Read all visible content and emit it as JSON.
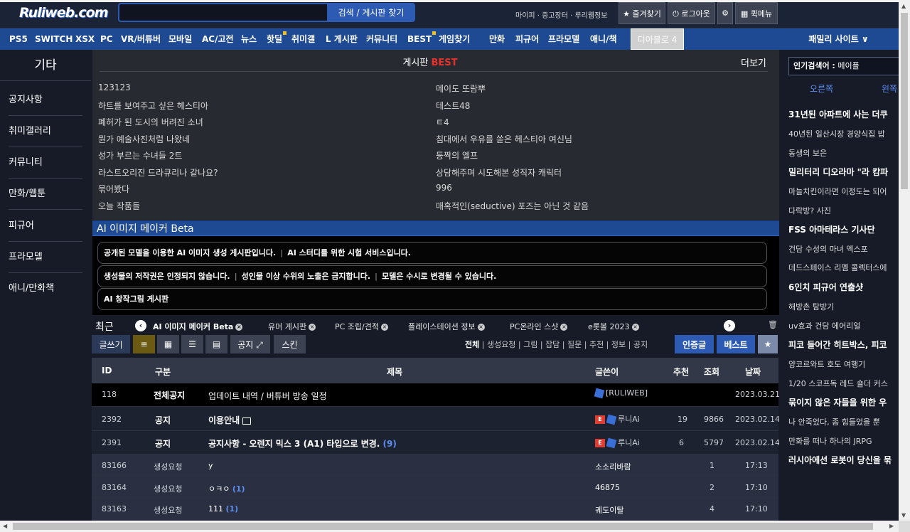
{
  "header": {
    "logo": "Ruliweb.com",
    "search_placeholder": "",
    "search_button": "검색 / 게시판 찾기",
    "top_links": "마이피 · 중고장터 · 루리웹정보",
    "favorites": "★ 즐겨찾기",
    "logout": "⏻ 로그아웃",
    "settings": "⚙",
    "quickmenu": "▦ 퀵메뉴"
  },
  "nav": [
    "PS5",
    "SWITCH",
    "XSX",
    "PC",
    "VR/버튜버",
    "모바일",
    "AC/고전",
    "뉴스",
    "핫딜",
    "취미갤",
    "L 게시판",
    "커뮤니티",
    "BEST",
    "게임찾기",
    "만화",
    "피규어",
    "프라모델",
    "애니/책"
  ],
  "nav_extra": {
    "diablo": "디아블로 4",
    "family": "패밀리 사이트 ∨"
  },
  "sidebar": {
    "title": "기타",
    "items": [
      "공지사항",
      "취미갤러리",
      "커뮤니티",
      "만화/웹툰",
      "피규어",
      "프라모델",
      "애니/만화책"
    ]
  },
  "best": {
    "title": "게시판",
    "title_accent": "BEST",
    "more": "더보기",
    "left": [
      "123123",
      "하트를 보여주고 싶은 헤스티아",
      "폐허가 된 도시의 버려진 소녀",
      "뭔가 예술사진처럼 나왔네",
      "성가 부르는 수녀들 2트",
      "라스트오리진 드라큐리나 같나요?",
      "묶어봤다",
      "오늘 작품들"
    ],
    "right": [
      "메이도 또람뿌",
      "테스트48",
      "ㅌ4",
      "침대에서 우유를 쏟은 헤스티아 여신님",
      "등짝의 엘프",
      "상담해주며 시도해본 성직자 캐릭터",
      "996",
      "매혹적인(seductive) 포즈는 아닌 것 같음"
    ]
  },
  "board": {
    "title": "AI 이미지 메이커 Beta",
    "notice1a": "공개된 모델을 이용한 AI 이미지 생성 게시판입니다.",
    "notice1b": "AI 스터디를 위한 시험 서비스입니다.",
    "notice2a": "생성물의 저작권은 인정되지 않습니다.",
    "notice2b": "성인물 이상 수위의 노출은 금지합니다.",
    "notice2c": "모델은 수시로 변경될 수 있습니다.",
    "notice3": "AI 창작그림 게시판",
    "sep": "|"
  },
  "recent": {
    "label": "최근",
    "items": [
      "AI 이미지 메이커 Beta",
      "유머 게시판",
      "PC 조립/견적",
      "플레이스테이션 정보",
      "PC온라인 스샷",
      "e롯볼 2023"
    ],
    "trash": "🗑"
  },
  "toolbar": {
    "write": "글쓰기",
    "notice": "공지 ⤢",
    "skin": "스킨",
    "filters_active": "전체",
    "filters": " | 생성요청 | 그림 | 잡담 | 질문 | 추천 | 정보 | 공지",
    "cert": "인증글",
    "best": "베스트",
    "star": "★"
  },
  "table": {
    "headers": {
      "id": "ID",
      "cat": "구분",
      "title": "제목",
      "author": "글쓴이",
      "rec": "추천",
      "views": "조회",
      "date": "날짜"
    },
    "rows": [
      {
        "id": "118",
        "cat": "전체공지",
        "title": "업데이트 내역 / 버튜버 방송 일정",
        "comments": "",
        "author": "[RULIWEB]",
        "rec": "",
        "views": "",
        "date": "2023.03.21"
      },
      {
        "id": "2392",
        "cat": "공지",
        "title": "이용안내",
        "comments": "",
        "author": "루니Ai",
        "rec": "19",
        "views": "9866",
        "date": "2023.02.14"
      },
      {
        "id": "2391",
        "cat": "공지",
        "title": "공지사항 - 오렌지 믹스 3 (A1) 타입으로 변경.",
        "comments": "(9)",
        "author": "루니Ai",
        "rec": "6",
        "views": "5797",
        "date": "2023.02.14"
      },
      {
        "id": "83166",
        "cat": "생성요청",
        "title": "y",
        "comments": "",
        "author": "소소리바람",
        "rec": "1",
        "views": "",
        "date": "17:13"
      },
      {
        "id": "83164",
        "cat": "생성요청",
        "title": "ㅇㅋㅇ",
        "comments": "(1)",
        "author": "46875",
        "rec": "2",
        "views": "",
        "date": "17:10"
      },
      {
        "id": "83163",
        "cat": "생성요청",
        "title": "111",
        "comments": "(1)",
        "author": "궤도이탈",
        "rec": "4",
        "views": "",
        "date": "17:10"
      }
    ]
  },
  "right": {
    "pop_label": "인기검색어 :",
    "pop_value": "메이플",
    "tabs": [
      "오른쪽",
      "왼쪽"
    ],
    "items": [
      {
        "text": "31년된 아파트에 사는 더쿠",
        "bold": true
      },
      {
        "text": "40년된 일산시장 경양식집 밥",
        "bold": false
      },
      {
        "text": "동생의 보은",
        "bold": false
      },
      {
        "text": "밀리터리 디오라마 \"라 캄파",
        "bold": true
      },
      {
        "text": "마늘치킨이라면 이정도는 되어",
        "bold": false
      },
      {
        "text": "다락방? 사진",
        "bold": false
      },
      {
        "text": "FSS 아마테라스 기사단",
        "bold": true
      },
      {
        "text": "건담 수성의 마녀 엑스포",
        "bold": false
      },
      {
        "text": "데드스페이스 리멤 콜렉터스에",
        "bold": false
      },
      {
        "text": "6인치 피규어 연출샷",
        "bold": true
      },
      {
        "text": "해방촌 탐방기",
        "bold": false
      },
      {
        "text": "uv효과 건담 에어리얼",
        "bold": false
      },
      {
        "text": "피코 들어간 히트박스, 피코",
        "bold": true
      },
      {
        "text": "양코르와트 호도 여행기",
        "bold": false
      },
      {
        "text": "1/20 스코프독 레드 숄더 커스",
        "bold": false
      },
      {
        "text": "묶이지 않은 자들을 위한 우",
        "bold": true
      },
      {
        "text": "나 안죽었다, 좀 힘들었을 뿐",
        "bold": false
      },
      {
        "text": "만화를 떠나 하나의 JRPG",
        "bold": false
      },
      {
        "text": "러시아에선 로봇이 당신을 묶",
        "bold": true
      }
    ]
  },
  "colors": {
    "accent": "#1e4a94",
    "best_red": "#e5322b",
    "background": "#161b27",
    "comment_blue": "#5b8cf0"
  }
}
